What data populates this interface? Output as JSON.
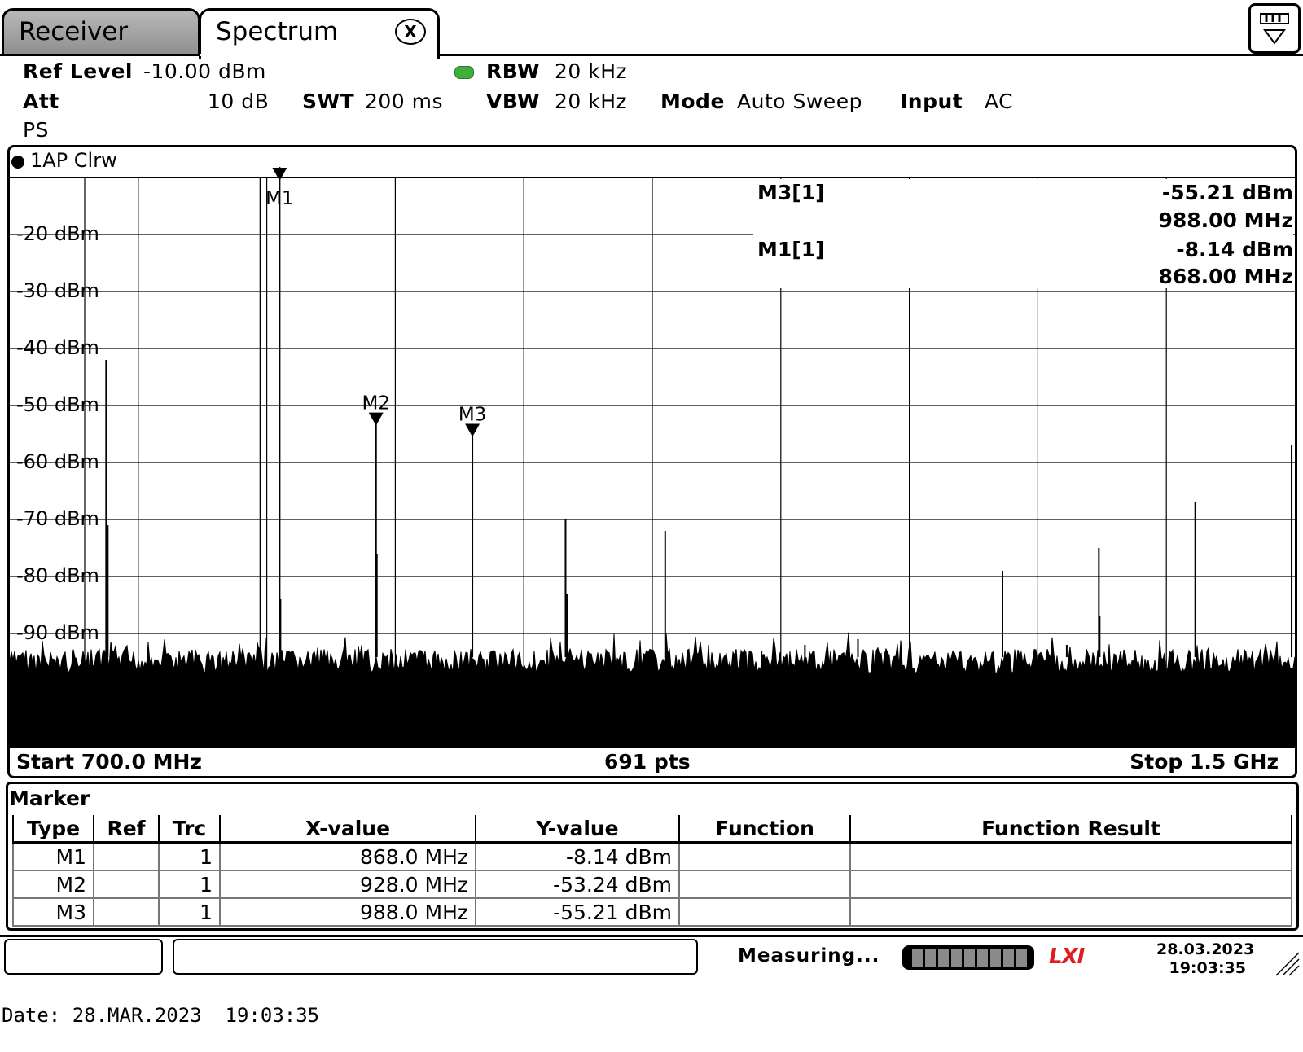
{
  "tabs": [
    {
      "label": "Receiver"
    },
    {
      "label": "Spectrum"
    }
  ],
  "tab_close_label": "X",
  "settings": {
    "ref_level_label": "Ref Level",
    "ref_level_value": "-10.00 dBm",
    "att_label": "Att",
    "att_value": "10 dB",
    "swt_label": "SWT",
    "swt_value": "200 ms",
    "rbw_label": "RBW",
    "rbw_value": "20 kHz",
    "vbw_label": "VBW",
    "vbw_value": "20 kHz",
    "mode_label": "Mode",
    "mode_value": "Auto Sweep",
    "input_label": "Input",
    "input_value": "AC",
    "ps_label": "PS"
  },
  "trace_label": "1AP Clrw",
  "marker_info": [
    {
      "name": "M3[1]",
      "level": "-55.21 dBm",
      "freq": "988.00 MHz"
    },
    {
      "name": "M1[1]",
      "level": "-8.14 dBm",
      "freq": "868.00 MHz"
    }
  ],
  "footer": {
    "start": "Start 700.0 MHz",
    "points": "691 pts",
    "stop": "Stop 1.5 GHz"
  },
  "chart_data": {
    "type": "line",
    "x_unit": "MHz",
    "y_unit": "dBm",
    "xlim": [
      700,
      1500
    ],
    "ylim": [
      -110,
      -10
    ],
    "y_ticks": [
      "-20 dBm",
      "-30 dBm",
      "-40 dBm",
      "-50 dBm",
      "-60 dBm",
      "-70 dBm",
      "-80 dBm",
      "-90 dBm"
    ],
    "y_tick_values": [
      -20,
      -30,
      -40,
      -50,
      -60,
      -70,
      -80,
      -90
    ],
    "noise_floor": -97,
    "peaks": [
      {
        "x": 760,
        "y": -42
      },
      {
        "x": 761,
        "y": -71
      },
      {
        "x": 856,
        "y": -10
      },
      {
        "x": 868,
        "y": -8.14
      },
      {
        "x": 868.5,
        "y": -84
      },
      {
        "x": 928,
        "y": -53.24
      },
      {
        "x": 928.5,
        "y": -76
      },
      {
        "x": 988,
        "y": -55.21
      },
      {
        "x": 1046,
        "y": -70
      },
      {
        "x": 1047,
        "y": -83
      },
      {
        "x": 1108,
        "y": -72
      },
      {
        "x": 1168,
        "y": -93
      },
      {
        "x": 1195,
        "y": -92
      },
      {
        "x": 1228,
        "y": -91
      },
      {
        "x": 1318,
        "y": -79
      },
      {
        "x": 1358,
        "y": -92
      },
      {
        "x": 1378,
        "y": -75
      },
      {
        "x": 1378.5,
        "y": -87
      },
      {
        "x": 1438,
        "y": -67
      },
      {
        "x": 1498,
        "y": -57
      }
    ],
    "markers": [
      {
        "name": "M1",
        "x": 868,
        "y": -8.14
      },
      {
        "name": "M2",
        "x": 928,
        "y": -53.24
      },
      {
        "name": "M3",
        "x": 988,
        "y": -55.21
      }
    ],
    "grid": true,
    "color": "#000000"
  },
  "marker_table": {
    "title": "Marker",
    "headers": [
      "Type",
      "Ref",
      "Trc",
      "X-value",
      "Y-value",
      "Function",
      "Function Result"
    ],
    "rows": [
      [
        "M1",
        "",
        "1",
        "868.0 MHz",
        "-8.14 dBm",
        "",
        ""
      ],
      [
        "M2",
        "",
        "1",
        "928.0 MHz",
        "-53.24 dBm",
        "",
        ""
      ],
      [
        "M3",
        "",
        "1",
        "988.0 MHz",
        "-55.21 dBm",
        "",
        ""
      ]
    ]
  },
  "status": {
    "text": "Measuring...",
    "date": "28.03.2023",
    "time": "19:03:35",
    "logo": "LXI"
  },
  "date_line": "Date: 28.MAR.2023  19:03:35"
}
